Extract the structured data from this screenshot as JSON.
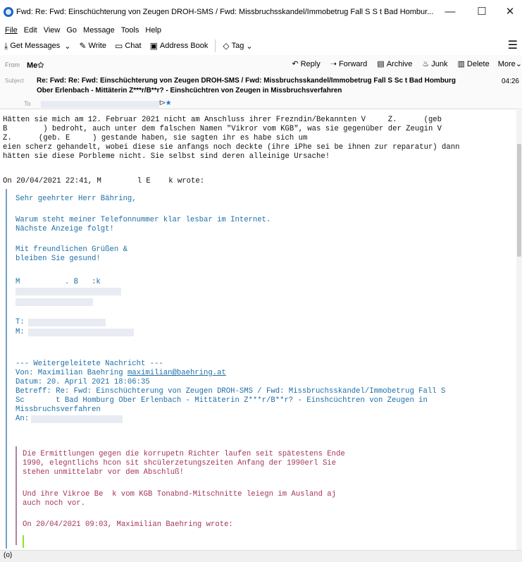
{
  "window": {
    "title": "Fwd: Re: Fwd: Einschüchterung von Zeugen DROH-SMS / Fwd: Missbruchsskandel/Immobetrug Fall S      S       t Bad Hombur...",
    "minimize": "—",
    "maximize": "☐",
    "close": "✕"
  },
  "menu": [
    "File",
    "Edit",
    "View",
    "Go",
    "Message",
    "Tools",
    "Help"
  ],
  "toolbar": {
    "get_messages": "Get Messages",
    "write": "Write",
    "chat": "Chat",
    "address_book": "Address Book",
    "tag": "Tag"
  },
  "header": {
    "from_label": "From",
    "from_value": "Me",
    "actions": {
      "reply": "Reply",
      "forward": "Forward",
      "archive": "Archive",
      "junk": "Junk",
      "delete": "Delete",
      "more": "More"
    },
    "subject_label": "Subject",
    "subject_line1": "Re: Fwd: Re: Fwd: Einschüchterung von Zeugen DROH-SMS / Fwd: Missbruchsskandel/Immobetrug Fall S      Sc       t Bad Homburg",
    "subject_line2": "Ober Erlenbach - Mittäterin Z***r/B**r? - Einshcüchtren von Zeugen in Missbruchsverfahren",
    "time": "04:26",
    "to_label": "To",
    "to_suffix": "t>"
  },
  "body": {
    "p1": [
      "Hätten sie mich am 12. Februar 2021 nicht am Anschluss ihrer Frezndin/Bekannten V     Z.      (geb",
      "B        ) bedroht, auch unter dem falschen Namen \"Vikror vom KGB\", was sie gegenüber der Zeugin V",
      "Z.      (geb. E     ) gestande haben, sie sagten ihr es habe sich um",
      "eien scherz gehandelt, wobei diese sie anfangs noch deckte (ihre iPhe sei be ihnen zur reparatur) dann",
      "hätten sie diese Porbleme nicht. Sie selbst sind deren alleinige Ursache!"
    ],
    "attribution1": "On 20/04/2021 22:41, M        l E    k wrote:",
    "q1_lines": {
      "greeting": "Sehr geehrter Herr Bähring,",
      "l1": "Warum steht meiner Telefonnummer klar lesbar im Internet.",
      "l2": "Nächste Anzeige folgt!",
      "l3": "Mit freundlichen Grüßen &",
      "l4": "bleiben Sie gesund!",
      "sig_name": "M          . B   :k",
      "sig_tel": "T:",
      "sig_m": "M:",
      "fwd_header": "--- Weitergeleitete Nachricht ---",
      "fwd_from_prefix": "Von: Maximilian Baehring ",
      "fwd_from_email": "maximilian@baehring.at",
      "fwd_date": "Datum: 20. April 2021 18:06:35",
      "fwd_subject1": "Betreff: Re: Fwd: Einschüchterung von Zeugen DROH-SMS / Fwd: Missbruchsskandel/Immobetrug Fall S",
      "fwd_subject2": "Sc       t Bad Homburg Ober Erlenbach - Mittäterin Z***r/B**r? - Einshcüchtren von Zeugen in",
      "fwd_subject3": "Missbruchsverfahren",
      "fwd_to": "An:"
    },
    "q2_lines": {
      "l1": "Die Ermittlungen gegen die korrupetn Richter laufen seit spätestens Ende",
      "l2": "1990, elegntlichs hcon sit shcülerzetungszeiten Anfang der 1990erl Sie",
      "l3": "stehen unmittelabr vor dem Abschluß!",
      "l4": "Und ihre Vikroe Be  k vom KGB Tonabnd-Mitschnitte leiegn im Ausland aj",
      "l5": "auch noch vor.",
      "attribution": "On 20/04/2021 09:03, Maximilian Baehring wrote:"
    }
  },
  "status": "(o)"
}
